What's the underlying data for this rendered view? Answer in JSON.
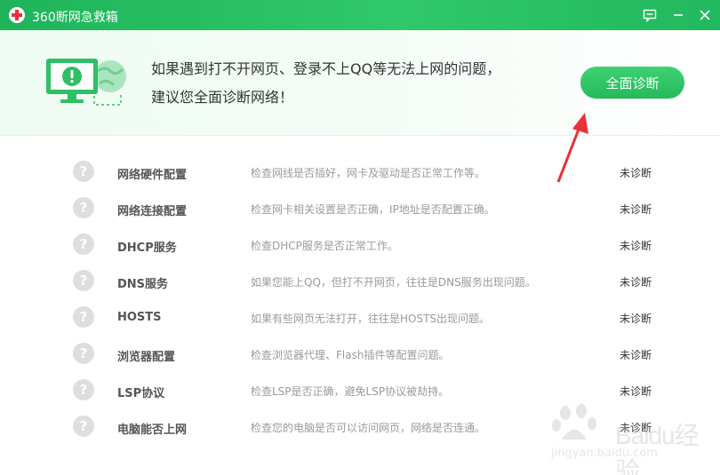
{
  "window": {
    "title": "360断网急救箱"
  },
  "header": {
    "line1": "如果遇到打不开网页、登录不上QQ等无法上网的问题，",
    "line2": "建议您全面诊断网络！",
    "diagnose_button": "全面诊断"
  },
  "items": [
    {
      "name": "网络硬件配置",
      "desc": "检查网线是否插好，网卡及驱动是否正常工作等。",
      "status": "未诊断"
    },
    {
      "name": "网络连接配置",
      "desc": "检查网卡相关设置是否正确，IP地址是否配置正确。",
      "status": "未诊断"
    },
    {
      "name": "DHCP服务",
      "desc": "检查DHCP服务是否正常工作。",
      "status": "未诊断"
    },
    {
      "name": "DNS服务",
      "desc": "如果您能上QQ，但打不开网页，往往是DNS服务出现问题。",
      "status": "未诊断"
    },
    {
      "name": "HOSTS",
      "desc": "如果有些网页无法打开，往往是HOSTS出现问题。",
      "status": "未诊断"
    },
    {
      "name": "浏览器配置",
      "desc": "检查浏览器代理、Flash插件等配置问题。",
      "status": "未诊断"
    },
    {
      "name": "LSP协议",
      "desc": "检查LSP是否正确，避免LSP协议被劫持。",
      "status": "未诊断"
    },
    {
      "name": "电脑能否上网",
      "desc": "检查您的电脑是否可以访问网页，网络是否连通。",
      "status": "未诊断"
    }
  ],
  "watermark": {
    "text": "Baidu经验",
    "url": "jingyan.baidu.com"
  },
  "colors": {
    "brand_green": "#2fc86a",
    "button_green": "#25b95b",
    "annotation_red": "#e8313a"
  },
  "icons": {
    "app": "red-cross-icon",
    "feedback": "feedback-icon",
    "minimize": "minimize-icon",
    "close": "close-icon",
    "row": "question-mark-icon"
  }
}
